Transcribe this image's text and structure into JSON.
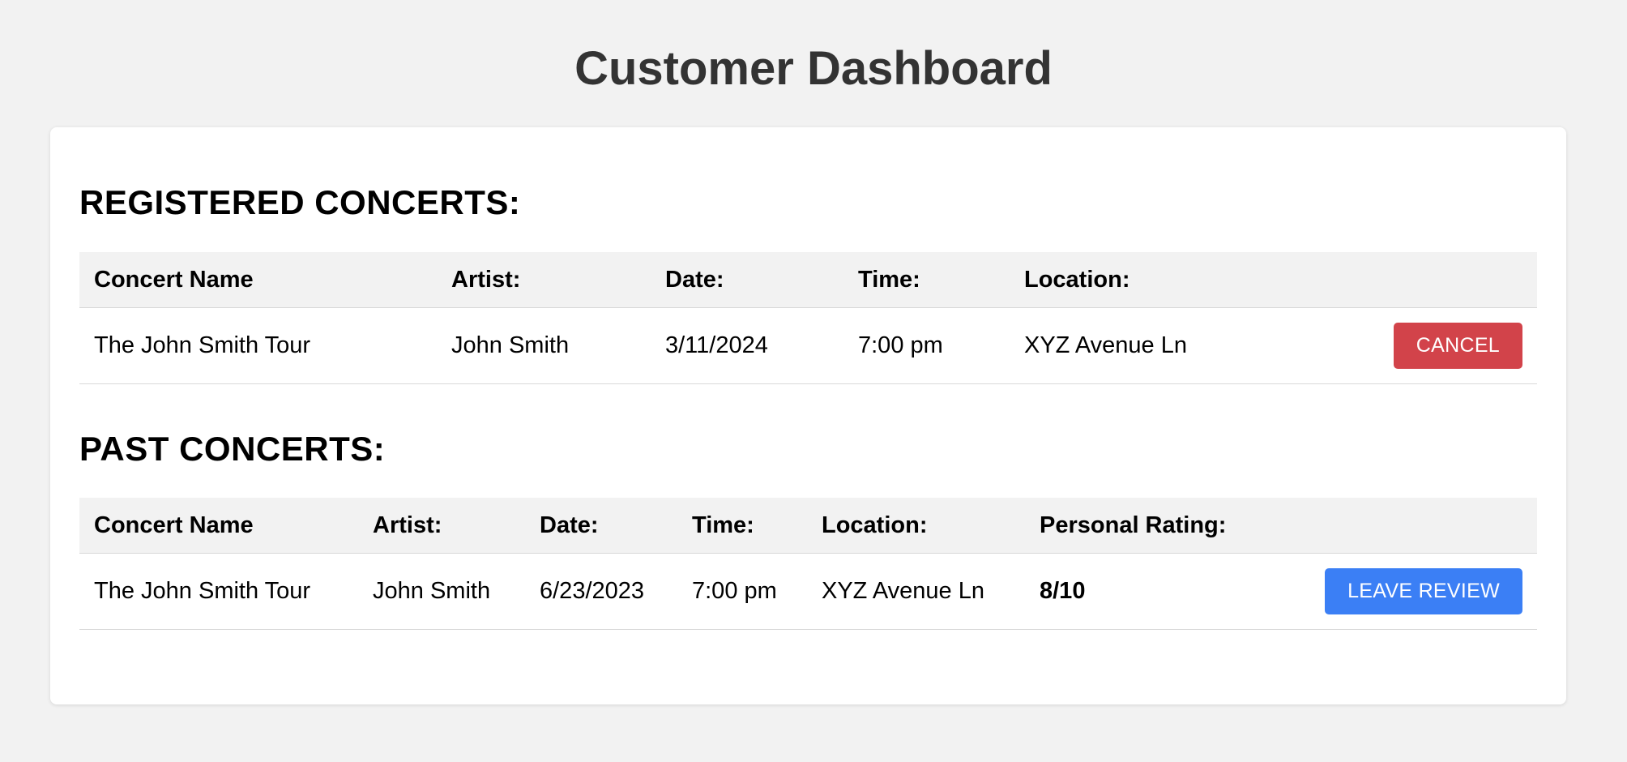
{
  "page": {
    "title": "Customer Dashboard"
  },
  "registered": {
    "title": "REGISTERED CONCERTS:",
    "headers": [
      "Concert Name",
      "Artist:",
      "Date:",
      "Time:",
      "Location:"
    ],
    "rows": [
      {
        "concert_name": "The John Smith Tour",
        "artist": "John Smith",
        "date": "3/11/2024",
        "time": "7:00 pm",
        "location": "XYZ Avenue Ln",
        "action_label": "CANCEL"
      }
    ]
  },
  "past": {
    "title": "PAST CONCERTS:",
    "headers": [
      "Concert Name",
      "Artist:",
      "Date:",
      "Time:",
      "Location:",
      "Personal Rating:"
    ],
    "rows": [
      {
        "concert_name": "The John Smith Tour",
        "artist": "John Smith",
        "date": "6/23/2023",
        "time": "7:00 pm",
        "location": "XYZ Avenue Ln",
        "rating": "8/10",
        "action_label": "LEAVE REVIEW"
      }
    ]
  },
  "colors": {
    "background": "#f2f2f2",
    "card": "#ffffff",
    "title_text": "#333333",
    "cancel_button": "#d2434a",
    "review_button": "#3b7ff5"
  }
}
